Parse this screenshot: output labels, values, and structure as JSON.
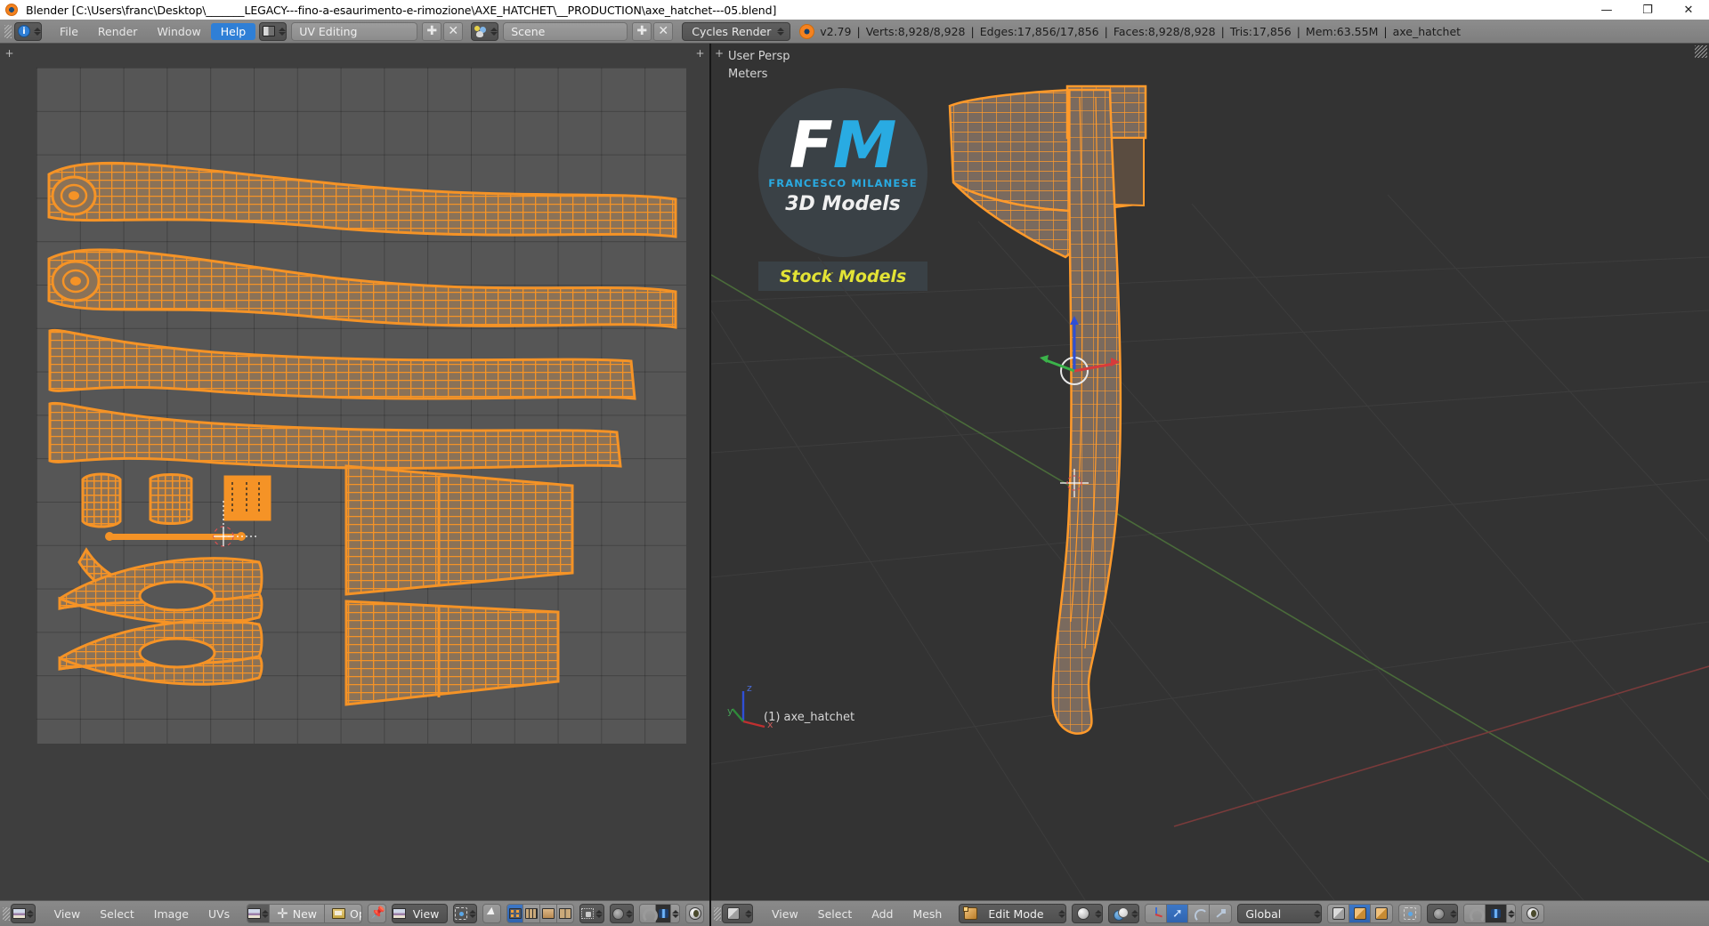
{
  "window": {
    "title": "Blender [C:\\Users\\franc\\Desktop\\_______LEGACY---fino-a-esaurimento-e-rimozione\\AXE_HATCHET\\__PRODUCTION\\axe_hatchet---05.blend]",
    "app_icon": "blender-logo-icon",
    "controls": {
      "minimize": "—",
      "maximize": "❐",
      "close": "✕"
    }
  },
  "topbar": {
    "editor_type_icon": "info-editor-icon",
    "menus": [
      {
        "label": "File"
      },
      {
        "label": "Render"
      },
      {
        "label": "Window"
      },
      {
        "label": "Help",
        "active": true
      }
    ],
    "screen_layout": {
      "icon": "screen-layout-icon",
      "value": "UV Editing",
      "add": "✚",
      "remove": "✕"
    },
    "scene": {
      "icon": "scene-icon",
      "value": "Scene",
      "add": "✚",
      "remove": "✕"
    },
    "render_engine": {
      "value": "Cycles Render"
    },
    "status": {
      "logo": "blender-logo-icon",
      "version": "v2.79",
      "verts": "Verts:8,928/8,928",
      "edges": "Edges:17,856/17,856",
      "faces": "Faces:8,928/8,928",
      "tris": "Tris:17,856",
      "mem": "Mem:63.55M",
      "object": "axe_hatchet",
      "separator": "|"
    }
  },
  "uv_editor": {
    "name": "UV/Image Editor",
    "header": {
      "editor_icon": "uv-image-editor-icon",
      "menus": [
        {
          "label": "View"
        },
        {
          "label": "Select"
        },
        {
          "label": "Image"
        },
        {
          "label": "UVs"
        }
      ],
      "image_datablock_icon": "image-datablock-icon",
      "new_label": "New",
      "new_icon": "plus-icon",
      "open_label": "Open",
      "open_icon": "folder-icon",
      "pin_icon": "pin-icon",
      "view_mode": {
        "icon": "image-icon",
        "value": "View"
      },
      "pivot_icon": "pivot-center-icon",
      "cursor_icon": "snap-cursor-icon",
      "uv_select_modes": [
        {
          "name": "vertex",
          "icon": "uv-vertex-icon",
          "active": true
        },
        {
          "name": "edge",
          "icon": "uv-edge-icon",
          "active": false
        },
        {
          "name": "face",
          "icon": "uv-face-icon",
          "active": false
        },
        {
          "name": "island",
          "icon": "uv-island-icon",
          "active": false
        }
      ],
      "sticky_icon": "sticky-selection-icon",
      "proportional_icon": "proportional-edit-icon",
      "snap_icon": "snap-magnet-icon",
      "snap_target_icon": "snap-target-icon",
      "uv_sync_icon": "uv-sync-icon"
    },
    "canvas": {
      "grid": true,
      "background_color": "#565656",
      "uv_color": "#f59326"
    }
  },
  "view3d": {
    "name": "3D View",
    "overlay": {
      "view_name": "User Persp",
      "units": "Meters",
      "object_label": "(1) axe_hatchet",
      "axis_gizmo": {
        "x": "x",
        "y": "y",
        "z": "z"
      }
    },
    "watermark": {
      "letter_f": "F",
      "letter_m": "M",
      "subtitle": "FRANCESCO MILANESE",
      "tagline": "3D Models",
      "badge": "Stock Models",
      "accent_color": "#29abe2",
      "badge_color": "#e3e335"
    },
    "header": {
      "editor_icon": "view3d-editor-icon",
      "menus": [
        {
          "label": "View"
        },
        {
          "label": "Select"
        },
        {
          "label": "Add"
        },
        {
          "label": "Mesh"
        }
      ],
      "mode": {
        "icon": "edit-mode-icon",
        "value": "Edit Mode"
      },
      "viewport_shading": {
        "icon": "solid-shading-icon"
      },
      "pivot": {
        "icon": "pivot-median-icon"
      },
      "manipulators": [
        {
          "name": "toggle",
          "icon": "manipulator-icon",
          "active": false
        },
        {
          "name": "translate",
          "icon": "translate-arrow-icon",
          "active": true
        },
        {
          "name": "rotate",
          "icon": "rotate-icon",
          "active": false
        },
        {
          "name": "scale",
          "icon": "scale-icon",
          "active": false
        }
      ],
      "transform_orientation": {
        "value": "Global"
      },
      "mesh_select_modes": [
        {
          "name": "vertex",
          "icon": "mesh-vertex-icon",
          "active": false
        },
        {
          "name": "edge",
          "icon": "mesh-edge-icon",
          "active": true
        },
        {
          "name": "face",
          "icon": "mesh-face-icon",
          "active": false
        }
      ],
      "limit_selection_icon": "limit-selection-icon",
      "proportional_icon": "proportional-edit-icon",
      "snap_icon": "snap-magnet-icon",
      "snap_target_icon": "snap-target-icon",
      "render_icon": "render-preview-icon"
    },
    "model": {
      "name": "axe_hatchet",
      "edge_color": "#ff9a2b",
      "face_color": "#7a6a5e"
    }
  }
}
